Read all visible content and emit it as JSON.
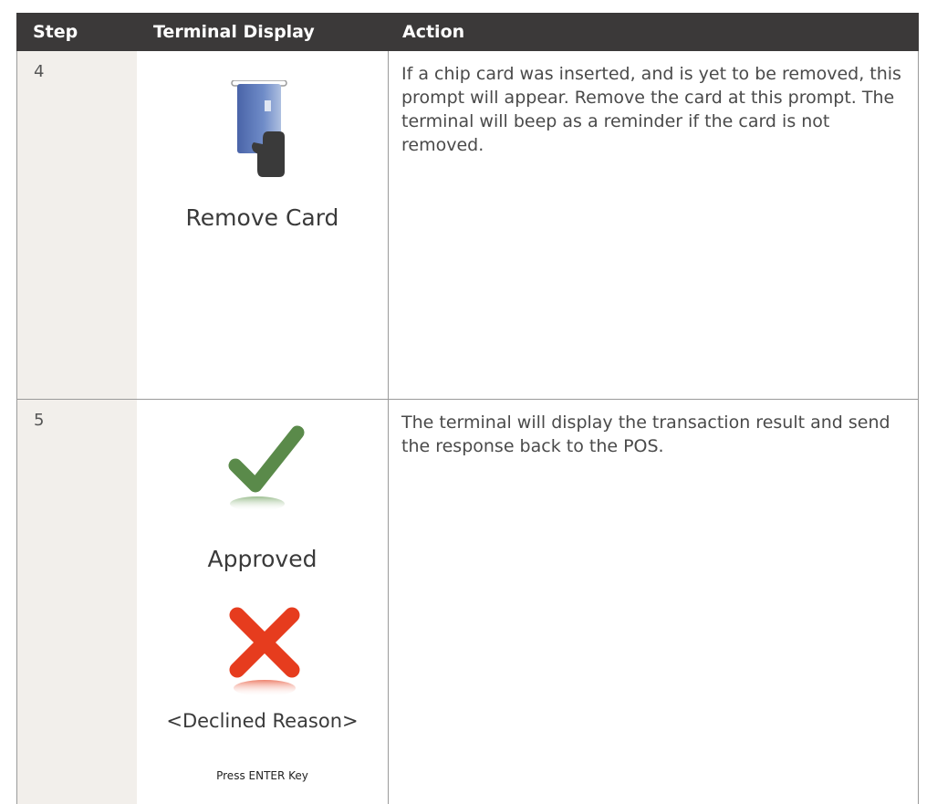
{
  "table": {
    "headers": {
      "step": "Step",
      "terminal_display": "Terminal Display",
      "action": "Action"
    },
    "rows": [
      {
        "step": "4",
        "display": {
          "icon": "remove-card-icon",
          "label": "Remove Card"
        },
        "action": "If a chip card was inserted, and is yet to be removed, this prompt will appear. Remove the card at this prompt. The terminal will beep as a reminder if the card is not removed."
      },
      {
        "step": "5",
        "display": {
          "approved_icon": "checkmark-icon",
          "approved_label": "Approved",
          "declined_icon": "cross-icon",
          "declined_label": "<Declined Reason>",
          "footer": "Press ENTER Key"
        },
        "action": "The terminal will display the transaction result and send the response back to the POS."
      }
    ]
  },
  "colors": {
    "header_bg": "#3b3939",
    "step_col_bg": "#f2efeb",
    "approved_green": "#5a8a4a",
    "declined_red": "#e63c1e",
    "card_blue": "#4f6fb0"
  }
}
